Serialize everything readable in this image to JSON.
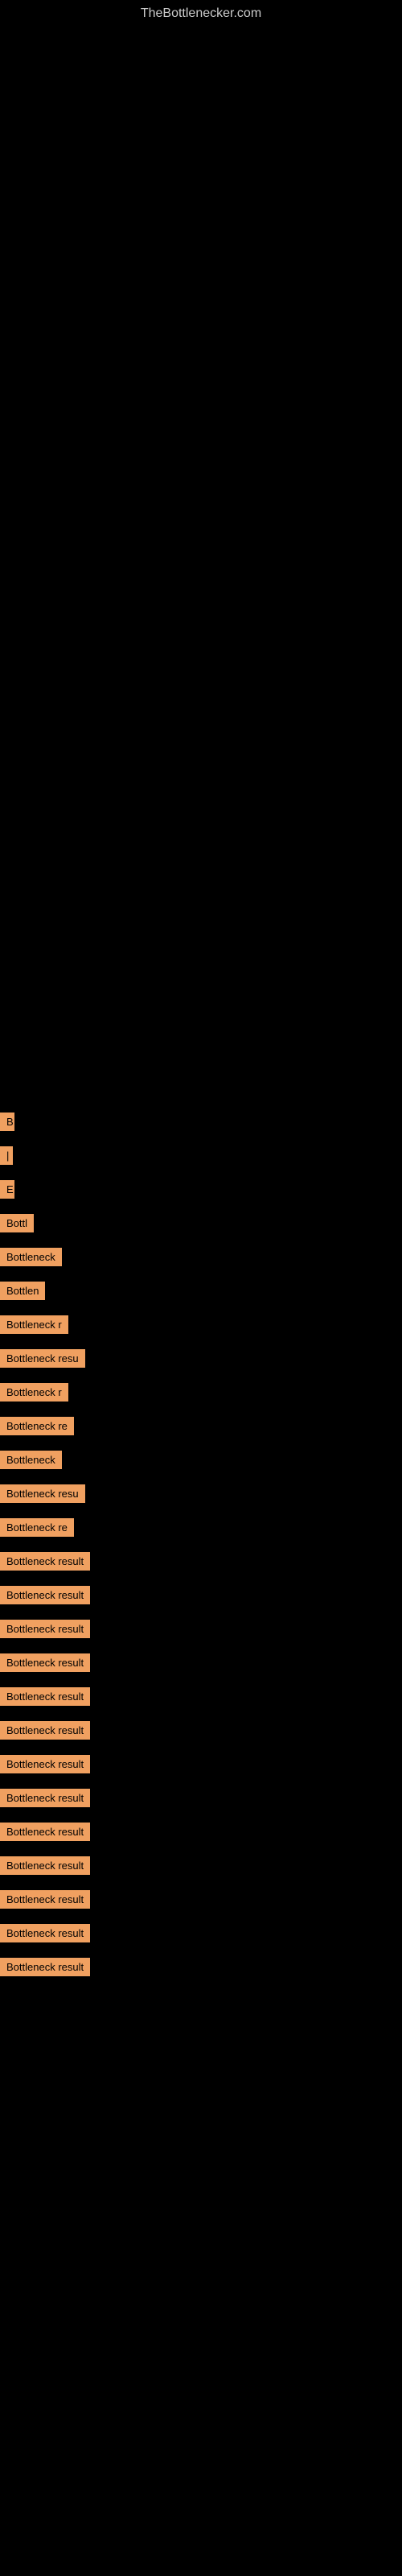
{
  "site": {
    "title": "TheBottlenecker.com"
  },
  "results": [
    {
      "id": 1,
      "label": "B",
      "width": 18
    },
    {
      "id": 2,
      "label": "|",
      "width": 10
    },
    {
      "id": 3,
      "label": "E",
      "width": 18
    },
    {
      "id": 4,
      "label": "Bottl",
      "width": 50
    },
    {
      "id": 5,
      "label": "Bottleneck",
      "width": 85
    },
    {
      "id": 6,
      "label": "Bottlen",
      "width": 68
    },
    {
      "id": 7,
      "label": "Bottleneck r",
      "width": 100
    },
    {
      "id": 8,
      "label": "Bottleneck resu",
      "width": 120
    },
    {
      "id": 9,
      "label": "Bottleneck r",
      "width": 100
    },
    {
      "id": 10,
      "label": "Bottleneck re",
      "width": 110
    },
    {
      "id": 11,
      "label": "Bottleneck",
      "width": 88
    },
    {
      "id": 12,
      "label": "Bottleneck resu",
      "width": 125
    },
    {
      "id": 13,
      "label": "Bottleneck re",
      "width": 112
    },
    {
      "id": 14,
      "label": "Bottleneck result",
      "width": 140
    },
    {
      "id": 15,
      "label": "Bottleneck result",
      "width": 140
    },
    {
      "id": 16,
      "label": "Bottleneck result",
      "width": 140
    },
    {
      "id": 17,
      "label": "Bottleneck result",
      "width": 140
    },
    {
      "id": 18,
      "label": "Bottleneck result",
      "width": 140
    },
    {
      "id": 19,
      "label": "Bottleneck result",
      "width": 140
    },
    {
      "id": 20,
      "label": "Bottleneck result",
      "width": 140
    },
    {
      "id": 21,
      "label": "Bottleneck result",
      "width": 140
    },
    {
      "id": 22,
      "label": "Bottleneck result",
      "width": 140
    },
    {
      "id": 23,
      "label": "Bottleneck result",
      "width": 140
    },
    {
      "id": 24,
      "label": "Bottleneck result",
      "width": 140
    },
    {
      "id": 25,
      "label": "Bottleneck result",
      "width": 140
    },
    {
      "id": 26,
      "label": "Bottleneck result",
      "width": 140
    }
  ]
}
